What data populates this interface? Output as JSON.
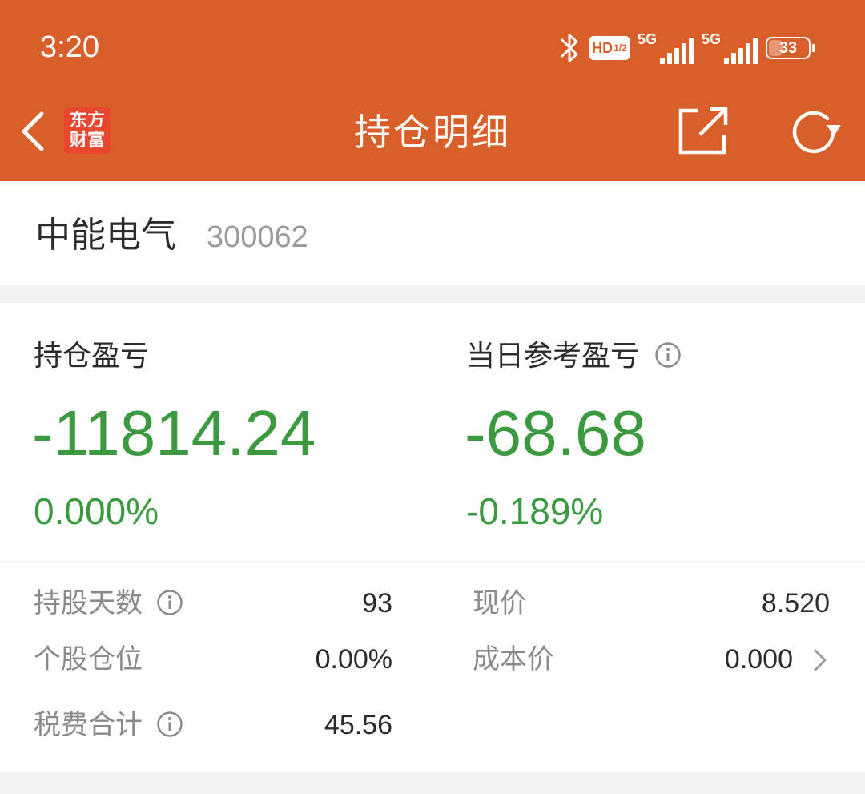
{
  "status_bar": {
    "time": "3:20",
    "hd_label": "HD",
    "hd_sub": "1/2",
    "signal1_label": "5G",
    "signal2_label": "5G",
    "battery_level": "33",
    "bluetooth_icon": "bluetooth-icon"
  },
  "header": {
    "back_icon": "chevron-left-icon",
    "logo_line1": "东方",
    "logo_line2": "财富",
    "title": "持仓明细",
    "share_icon": "share-icon",
    "refresh_icon": "refresh-icon",
    "bg_color": "#d95f2a"
  },
  "stock": {
    "name": "中能电气",
    "code": "300062"
  },
  "position_pl": {
    "label": "持仓盈亏",
    "value": "-11814.24",
    "percent": "0.000%"
  },
  "daily_pl": {
    "label": "当日参考盈亏",
    "value": "-68.68",
    "percent": "-0.189%"
  },
  "details": {
    "holding_days_label": "持股天数",
    "holding_days_value": "93",
    "position_ratio_label": "个股仓位",
    "position_ratio_value": "0.00%",
    "fees_label": "税费合计",
    "fees_value": "45.56",
    "current_price_label": "现价",
    "current_price_value": "8.520",
    "cost_price_label": "成本价",
    "cost_price_value": "0.000"
  },
  "colors": {
    "loss_green": "#3b9a3f",
    "text_primary": "#2b2b2b",
    "text_secondary": "#8a8a8a"
  }
}
